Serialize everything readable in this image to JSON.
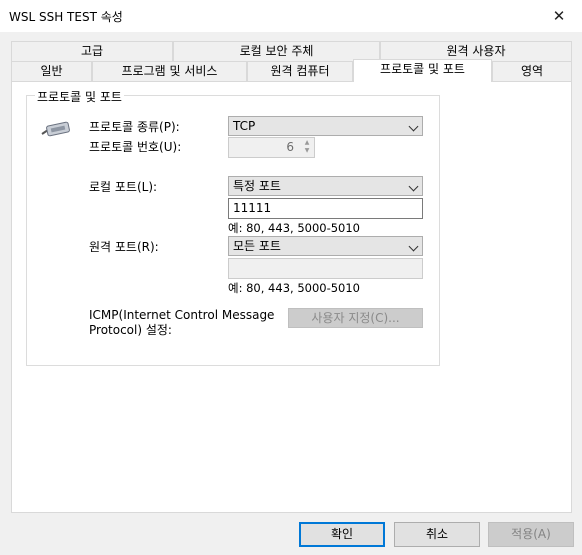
{
  "window": {
    "title": "WSL SSH TEST 속성"
  },
  "tabs_row1": [
    "고급",
    "로컬 보안 주체",
    "원격 사용자"
  ],
  "tabs_row2": [
    "일반",
    "프로그램 및 서비스",
    "원격 컴퓨터",
    "프로토콜 및 포트",
    "영역"
  ],
  "group": {
    "title": "프로토콜 및 포트",
    "protocol_type_label": "프로토콜 종류(P):",
    "protocol_type_value": "TCP",
    "protocol_number_label": "프로토콜 번호(U):",
    "protocol_number_value": "6",
    "local_port_label": "로컬 포트(L):",
    "local_port_value": "특정 포트",
    "local_port_input": "11111",
    "local_port_hint": "예: 80, 443, 5000-5010",
    "remote_port_label": "원격 포트(R):",
    "remote_port_value": "모든 포트",
    "remote_port_input": "",
    "remote_port_hint": "예: 80, 443, 5000-5010",
    "icmp_label_line1": "ICMP(Internet Control Message",
    "icmp_label_line2": "Protocol) 설정:",
    "icmp_button": "사용자 지정(C)..."
  },
  "buttons": {
    "ok": "확인",
    "cancel": "취소",
    "apply": "적용(A)"
  }
}
